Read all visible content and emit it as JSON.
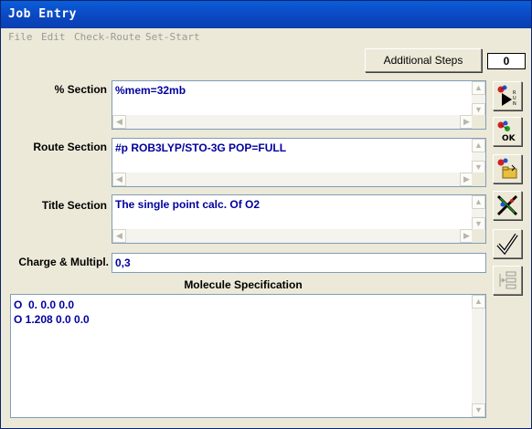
{
  "window": {
    "title": "Job Entry"
  },
  "menu": [
    "File",
    "Edit",
    "Check-Route",
    "Set-Start"
  ],
  "additional_steps_label": "Additional Steps",
  "step_count": "0",
  "sections": {
    "percent": {
      "label": "% Section",
      "value": "%mem=32mb"
    },
    "route": {
      "label": "Route Section",
      "value": "#p ROB3LYP/STO-3G POP=FULL"
    },
    "title": {
      "label": "Title Section",
      "value": "The single point calc. Of O2"
    },
    "charge": {
      "label": "Charge & Multipl.",
      "value": "0,3"
    }
  },
  "molecule": {
    "label": "Molecule Specification",
    "lines": [
      "O  0. 0.0 0.0",
      "O 1.208 0.0 0.0"
    ]
  },
  "toolbar": [
    "run-icon",
    "ok-icon",
    "folder-save-icon",
    "cancel-icon",
    "check-icon",
    "list-icon"
  ]
}
